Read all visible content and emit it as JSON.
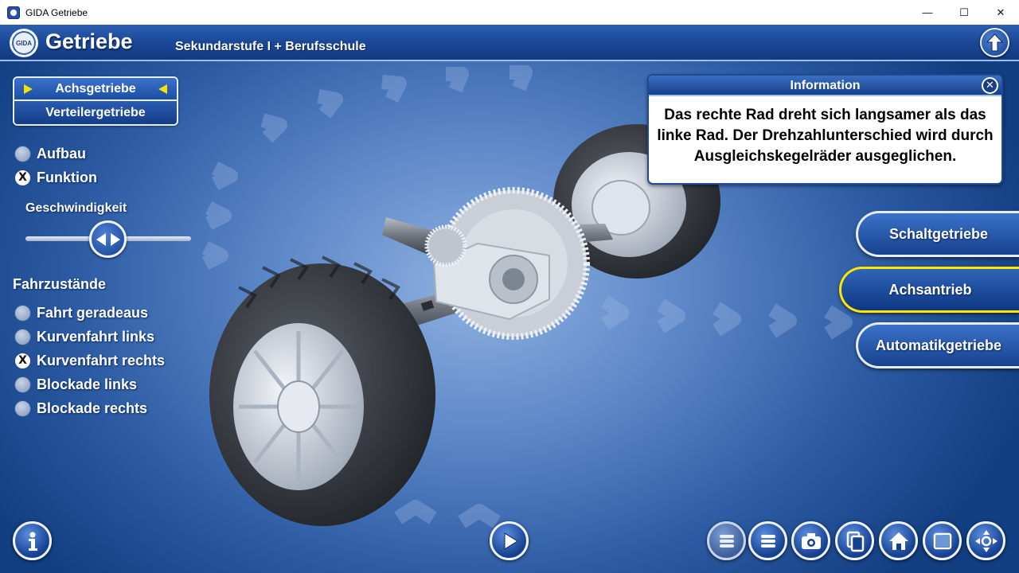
{
  "window": {
    "title": "GIDA Getriebe",
    "controls": {
      "minimize": "—",
      "maximize": "☐",
      "close": "✕"
    }
  },
  "header": {
    "logo_text": "GIDA",
    "title": "Getriebe",
    "subtitle": "Sekundarstufe I + Berufsschule"
  },
  "left_panel": {
    "selector": {
      "active": "Achsgetriebe",
      "inactive": "Verteilergetriebe"
    },
    "mode_options": [
      {
        "label": "Aufbau",
        "selected": false
      },
      {
        "label": "Funktion",
        "selected": true
      }
    ],
    "speed": {
      "label": "Geschwindigkeit",
      "level": 0.5
    },
    "driving_states_title": "Fahrzustände",
    "driving_states": [
      {
        "label": "Fahrt geradeaus",
        "selected": false
      },
      {
        "label": "Kurvenfahrt links",
        "selected": false
      },
      {
        "label": "Kurvenfahrt rechts",
        "selected": true
      },
      {
        "label": "Blockade links",
        "selected": false
      },
      {
        "label": "Blockade rechts",
        "selected": false
      }
    ]
  },
  "info_box": {
    "title": "Information",
    "text": "Das rechte Rad dreht sich langsamer als das linke Rad. Der Drehzahlunterschied wird durch Ausgleichskegelräder ausgeglichen."
  },
  "nav": [
    {
      "label": "Schaltgetriebe",
      "active": false
    },
    {
      "label": "Achsantrieb",
      "active": true
    },
    {
      "label": "Automatikgetriebe",
      "active": false
    }
  ],
  "bottom_bar": {
    "left": "info-icon",
    "center": "play-icon",
    "right": [
      "list-icon",
      "list-icon",
      "camera-icon",
      "copy-icon",
      "home-icon",
      "window-icon",
      "move-icon"
    ]
  },
  "colors": {
    "accent_yellow": "#f4e300",
    "header_blue": "#1a4897",
    "active_border": "#ffe600"
  }
}
